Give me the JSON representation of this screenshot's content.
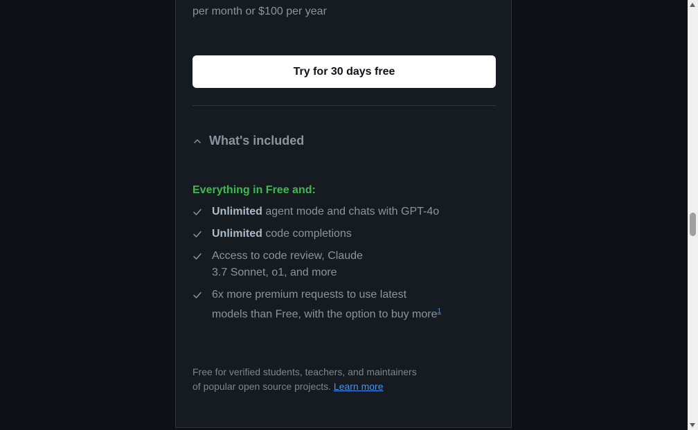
{
  "plan": {
    "price_sub": "per month or $100 per year",
    "cta_label": "Try for 30 days free",
    "included_toggle": "What's included",
    "includes_heading": "Everything in Free and:",
    "features": [
      {
        "bold": "Unlimited",
        "text": " agent mode and chats with GPT-4o"
      },
      {
        "bold": "Unlimited",
        "text": " code completions"
      },
      {
        "line1": "Access to code review, Claude",
        "line2": "3.7 Sonnet, o1, and more"
      },
      {
        "line1": "6x more premium requests to use latest",
        "line2": "models than Free, with the option to buy more",
        "footnote": "1"
      }
    ],
    "fineprint_line1": "Free for verified students, teachers, and maintainers",
    "fineprint_line2": "of popular open source projects.",
    "learn_more": "Learn more"
  },
  "colors": {
    "background": "#0d1117",
    "card": "#161b22",
    "accent_green": "#3fb950",
    "link_blue": "#4493f8",
    "muted_text": "#8b949e"
  },
  "icons": {
    "toggle": "chevron-up-icon",
    "feature": "check-icon"
  }
}
